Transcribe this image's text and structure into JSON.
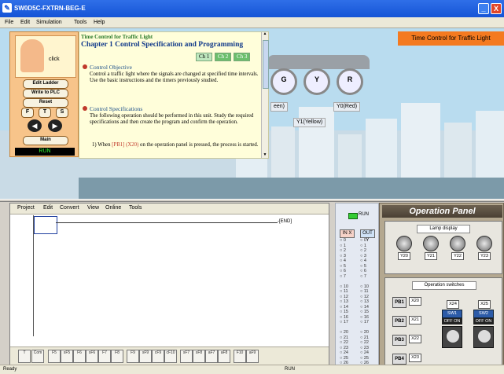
{
  "window": {
    "title": "SW0D5C-FXTRN-BEG-E",
    "minimize": "_",
    "close": "X"
  },
  "menubar": [
    "File",
    "Edit",
    "Simulation",
    "Tools",
    "Help"
  ],
  "control_panel": {
    "click_label": "click",
    "edit_ladder": "Edit Ladder",
    "write_plc": "Write to PLC",
    "reset": "Reset",
    "f": "F",
    "t": "T",
    "s": "S",
    "prev_icon": "arrow-left",
    "next_icon": "arrow-right",
    "main": "Main",
    "status": "RUN"
  },
  "text_panel": {
    "course": "Time Control for Traffic Light",
    "chapter": "Chapter 1  Control Specification and Programming",
    "tabs": [
      "Ch 1",
      "Ch 2",
      "Ch 3"
    ],
    "objective_title": "Control Objective",
    "objective_body": "Control a traffic light where the signals are changed at specified time intervals. Use the basic instructions and the timers previously studied.",
    "spec_title": "Control Specifications",
    "spec_body": "The following operation should be performed in this unit. Study the required specifications and then create the program and confirm the operation.",
    "step1_pre": "1) When ",
    "step1_pb": "[PB1] (X20)",
    "step1_post": " on the operation panel is pressed, the process is started."
  },
  "scene": {
    "banner": "Time Control for Traffic Light",
    "lamps": [
      "G",
      "Y",
      "R"
    ],
    "labels": {
      "green": "een)",
      "yellow": "Y1(Yellow)",
      "red": "Y0(Red)"
    }
  },
  "ladder": {
    "menu": [
      "Project",
      "Edit",
      "Convert",
      "View",
      "Online",
      "Tools"
    ],
    "end_label": "END",
    "toolbar": [
      "T",
      "Com",
      "F5",
      "sF5",
      "F6",
      "sF6",
      "F7",
      "F8",
      "F9",
      "sF9",
      "cF9",
      "cF10",
      "sF7",
      "sF8",
      "aF7",
      "aF8",
      "F10",
      "aF9"
    ]
  },
  "io_monitor": {
    "run_label": "RUN",
    "in_header": "IN X",
    "out_header": "OUT Y",
    "in_numbers": [
      "0",
      "1",
      "2",
      "3",
      "4",
      "5",
      "6",
      "7",
      "",
      "10",
      "11",
      "12",
      "13",
      "14",
      "15",
      "16",
      "17",
      "",
      "20",
      "21",
      "22",
      "23",
      "24",
      "25",
      "26",
      "27"
    ],
    "out_numbers": [
      "0",
      "1",
      "2",
      "3",
      "4",
      "5",
      "6",
      "7",
      "",
      "10",
      "11",
      "12",
      "13",
      "14",
      "15",
      "16",
      "17",
      "",
      "20",
      "21",
      "22",
      "23",
      "24",
      "25",
      "26",
      "27"
    ]
  },
  "operation_panel": {
    "title": "Operation Panel",
    "lamp_display": "Lamp display",
    "lamps": [
      "Y20",
      "Y21",
      "Y22",
      "Y23"
    ],
    "switches_title": "Operation switches",
    "buttons": [
      {
        "label": "PB1",
        "x": "X20"
      },
      {
        "label": "PB2",
        "x": "X21"
      },
      {
        "label": "PB3",
        "x": "X22"
      },
      {
        "label": "PB4",
        "x": "X23"
      }
    ],
    "x24": "X24",
    "x25": "X25",
    "sw1": "SW1",
    "sw2": "SW2",
    "off": "OFF",
    "on": "ON"
  },
  "statusbar": {
    "left": "Ready",
    "mode": "RUN"
  },
  "colors": {
    "titlebar": "#1554d6",
    "banner": "#f47a20",
    "panel": "#f7c48a",
    "tab_active": "#bfe8bf"
  }
}
